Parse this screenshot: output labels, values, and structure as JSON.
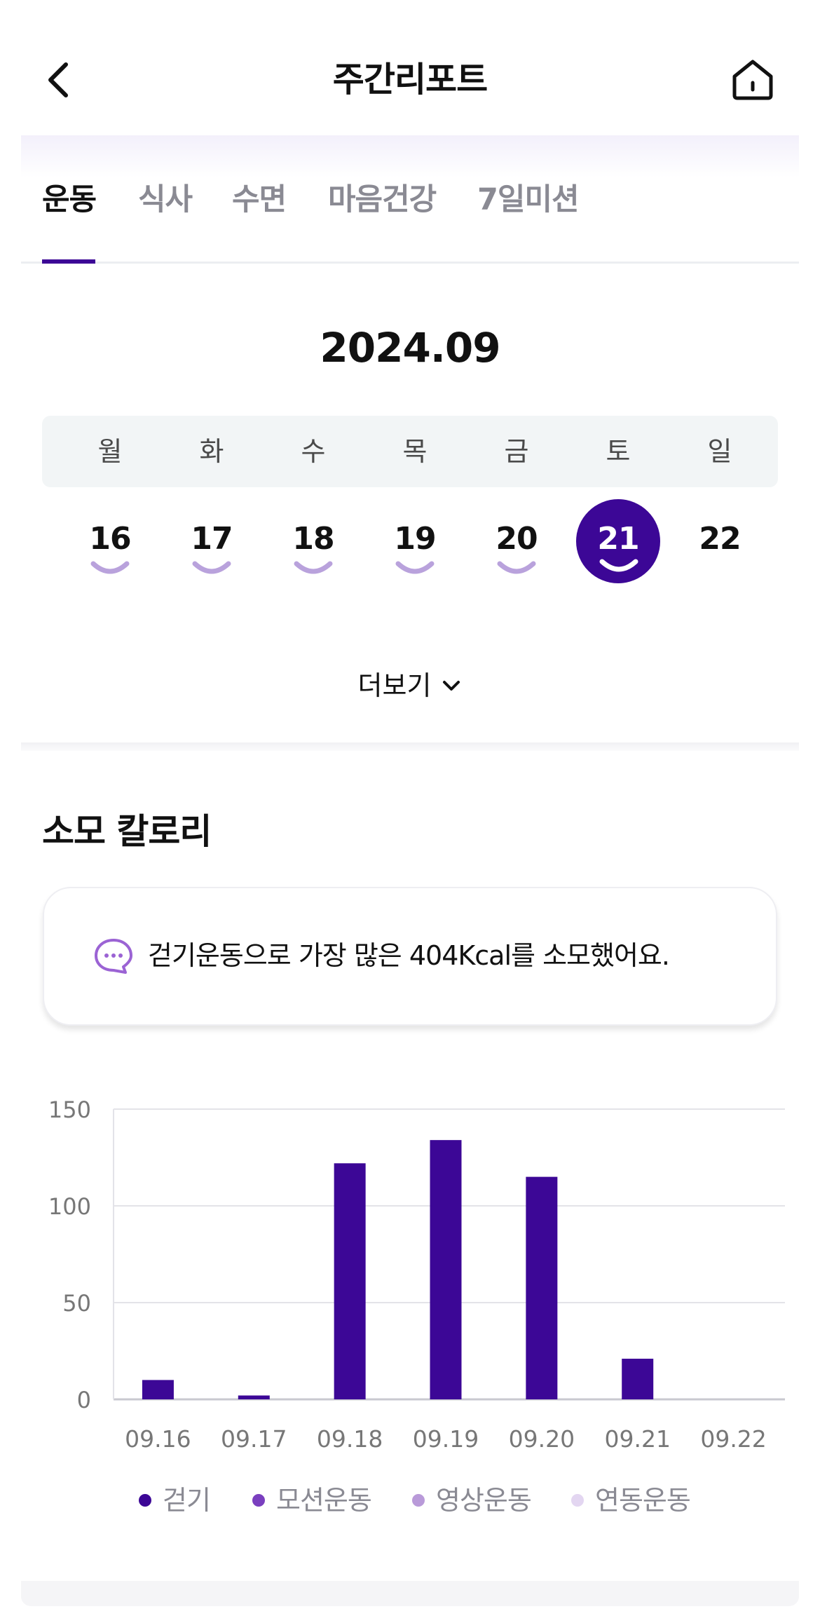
{
  "header": {
    "title": "주간리포트"
  },
  "tabs": [
    {
      "label": "운동",
      "active": true
    },
    {
      "label": "식사",
      "active": false
    },
    {
      "label": "수면",
      "active": false
    },
    {
      "label": "마음건강",
      "active": false
    },
    {
      "label": "7일미션",
      "active": false
    }
  ],
  "calendar": {
    "month": "2024.09",
    "weekdays": [
      "월",
      "화",
      "수",
      "목",
      "금",
      "토",
      "일"
    ],
    "days": [
      {
        "num": "16",
        "mark": true,
        "selected": false
      },
      {
        "num": "17",
        "mark": true,
        "selected": false
      },
      {
        "num": "18",
        "mark": true,
        "selected": false
      },
      {
        "num": "19",
        "mark": true,
        "selected": false
      },
      {
        "num": "20",
        "mark": true,
        "selected": false
      },
      {
        "num": "21",
        "mark": true,
        "selected": true
      },
      {
        "num": "22",
        "mark": false,
        "selected": false
      }
    ],
    "more_label": "더보기"
  },
  "calories": {
    "title": "소모 칼로리",
    "message": "걷기운동으로 가장 많은 404Kcal를 소모했어요."
  },
  "colors": {
    "accent": "#3c0796",
    "smile": "#b9a2dc",
    "series": [
      "#3c0796",
      "#7a3fbf",
      "#b99ad9",
      "#e3d6f1"
    ]
  },
  "chart_data": {
    "type": "bar",
    "categories": [
      "09.16",
      "09.17",
      "09.18",
      "09.19",
      "09.20",
      "09.21",
      "09.22"
    ],
    "series": [
      {
        "name": "걷기",
        "values": [
          10,
          2,
          122,
          134,
          115,
          21,
          0
        ]
      },
      {
        "name": "모션운동",
        "values": [
          0,
          0,
          0,
          0,
          0,
          0,
          0
        ]
      },
      {
        "name": "영상운동",
        "values": [
          0,
          0,
          0,
          0,
          0,
          0,
          0
        ]
      },
      {
        "name": "연동운동",
        "values": [
          0,
          0,
          0,
          0,
          0,
          0,
          0
        ]
      }
    ],
    "yticks": [
      "0",
      "50",
      "100",
      "150"
    ],
    "ylim": [
      0,
      150
    ],
    "grid": true,
    "legend": "bottom"
  }
}
